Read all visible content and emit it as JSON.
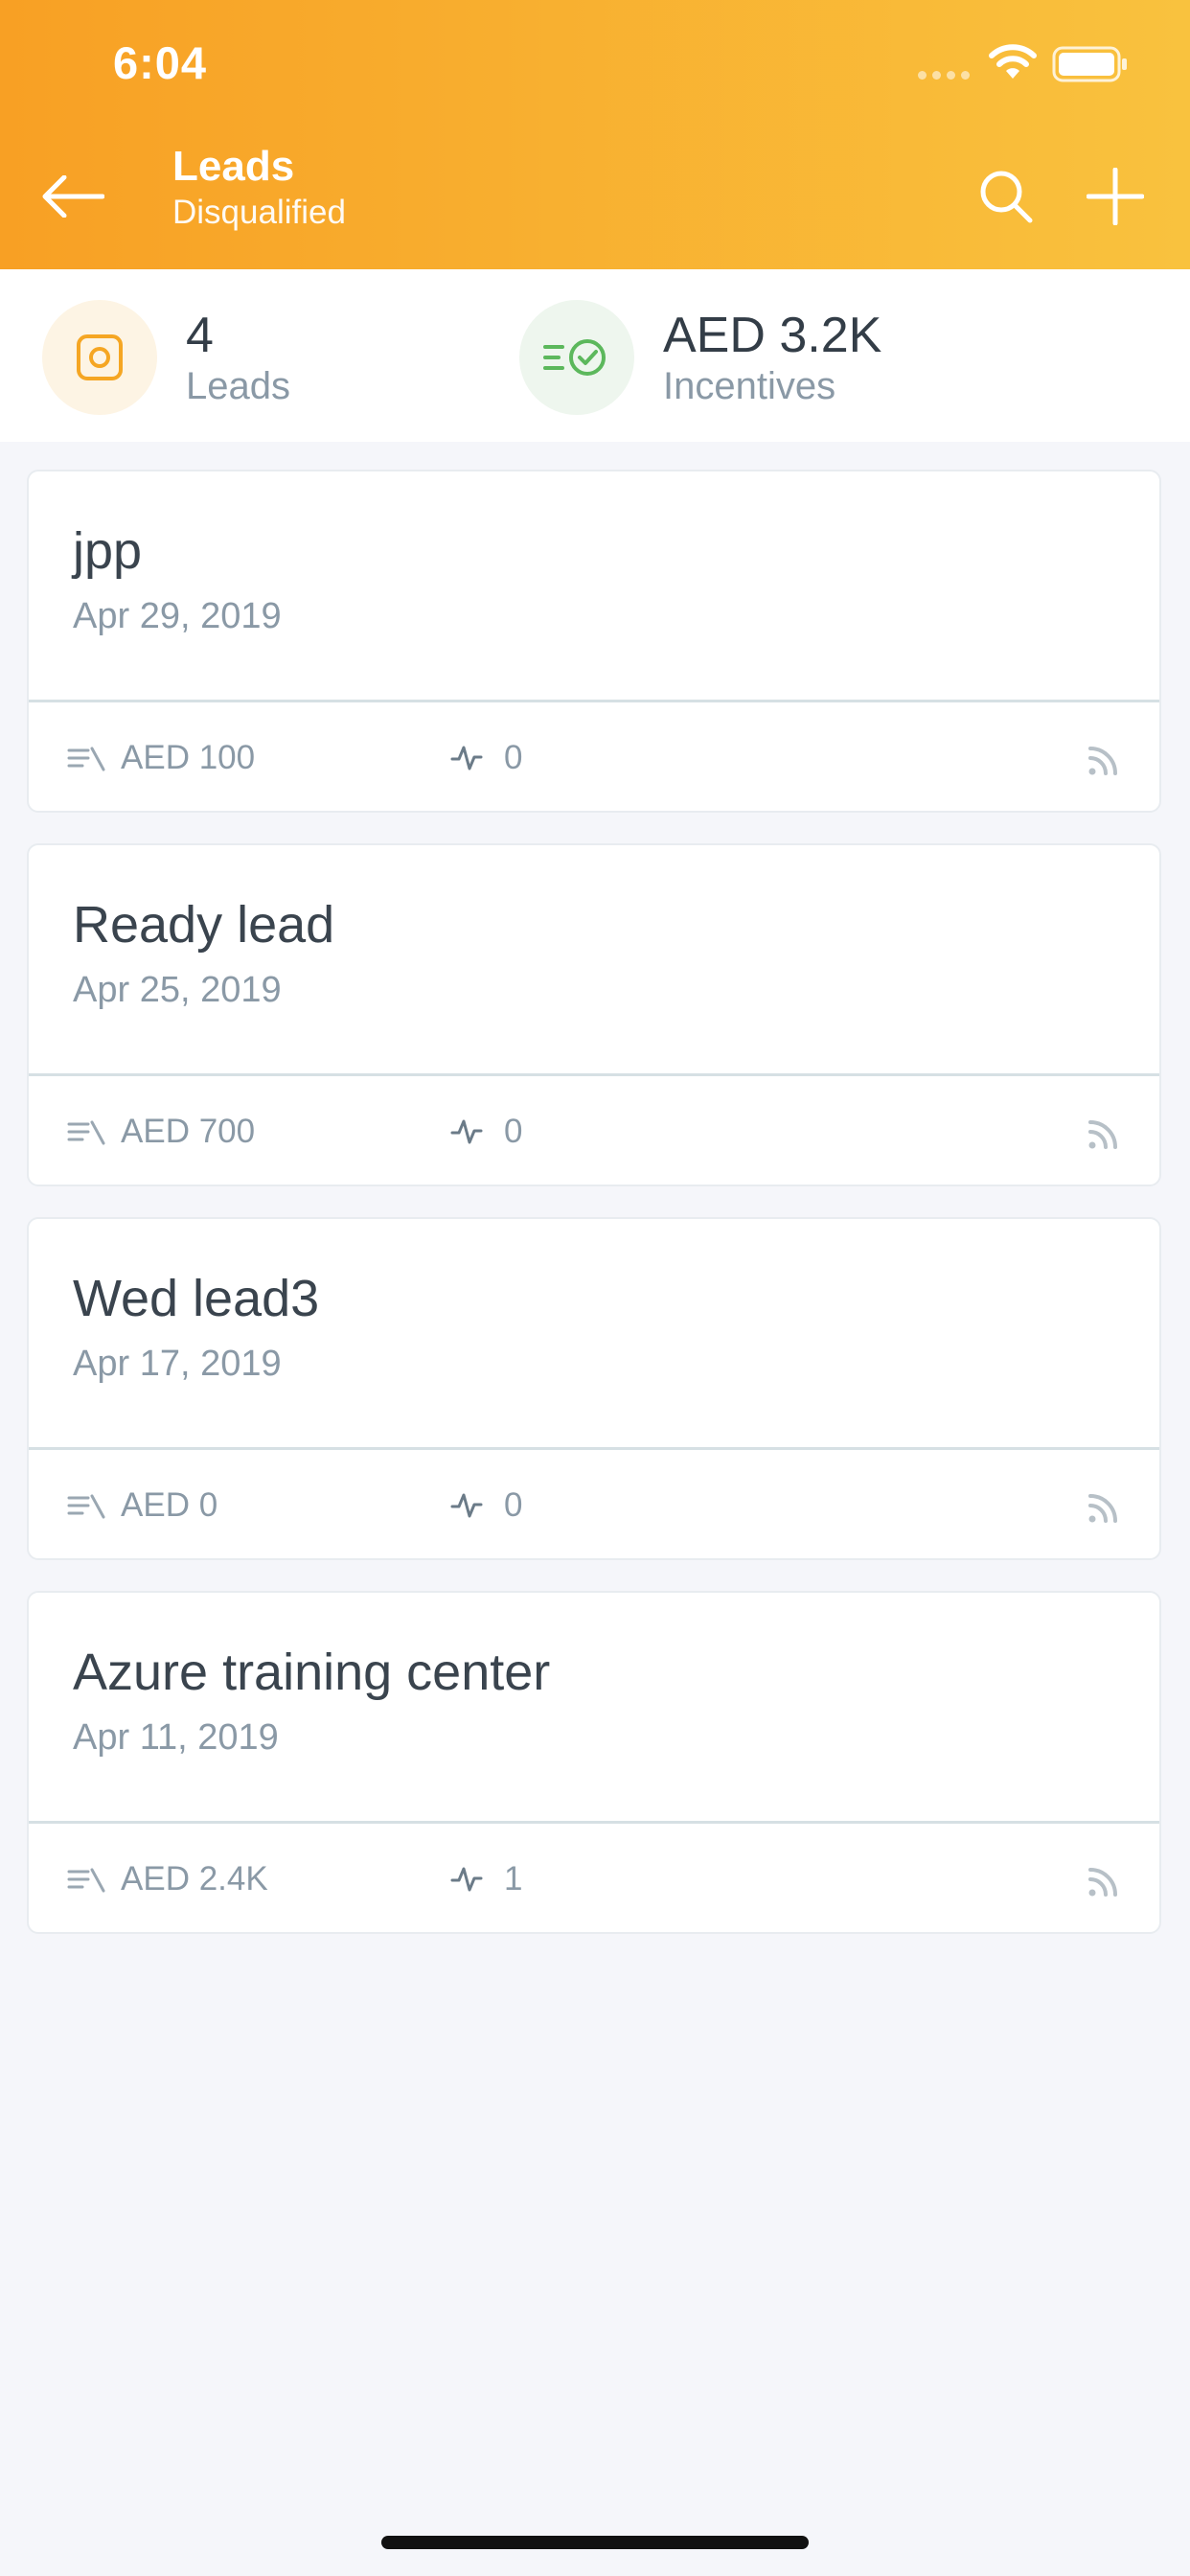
{
  "status_bar": {
    "time": "6:04"
  },
  "header": {
    "title": "Leads",
    "subtitle": "Disqualified"
  },
  "summary": {
    "leads": {
      "value": "4",
      "label": "Leads"
    },
    "incentives": {
      "value": "AED 3.2K",
      "label": "Incentives"
    }
  },
  "colors": {
    "header_start": "#f8a024",
    "header_end": "#f9c23e",
    "leads_icon": "#f5a623",
    "incentives_icon": "#5cb85c"
  },
  "leads": [
    {
      "name": "jpp",
      "date": "Apr 29, 2019",
      "amount": "AED 100",
      "activity": "0"
    },
    {
      "name": "Ready lead",
      "date": "Apr 25, 2019",
      "amount": "AED 700",
      "activity": "0"
    },
    {
      "name": "Wed lead3",
      "date": "Apr 17, 2019",
      "amount": "AED 0",
      "activity": "0"
    },
    {
      "name": "Azure training center",
      "date": "Apr 11, 2019",
      "amount": "AED 2.4K",
      "activity": "1"
    }
  ]
}
